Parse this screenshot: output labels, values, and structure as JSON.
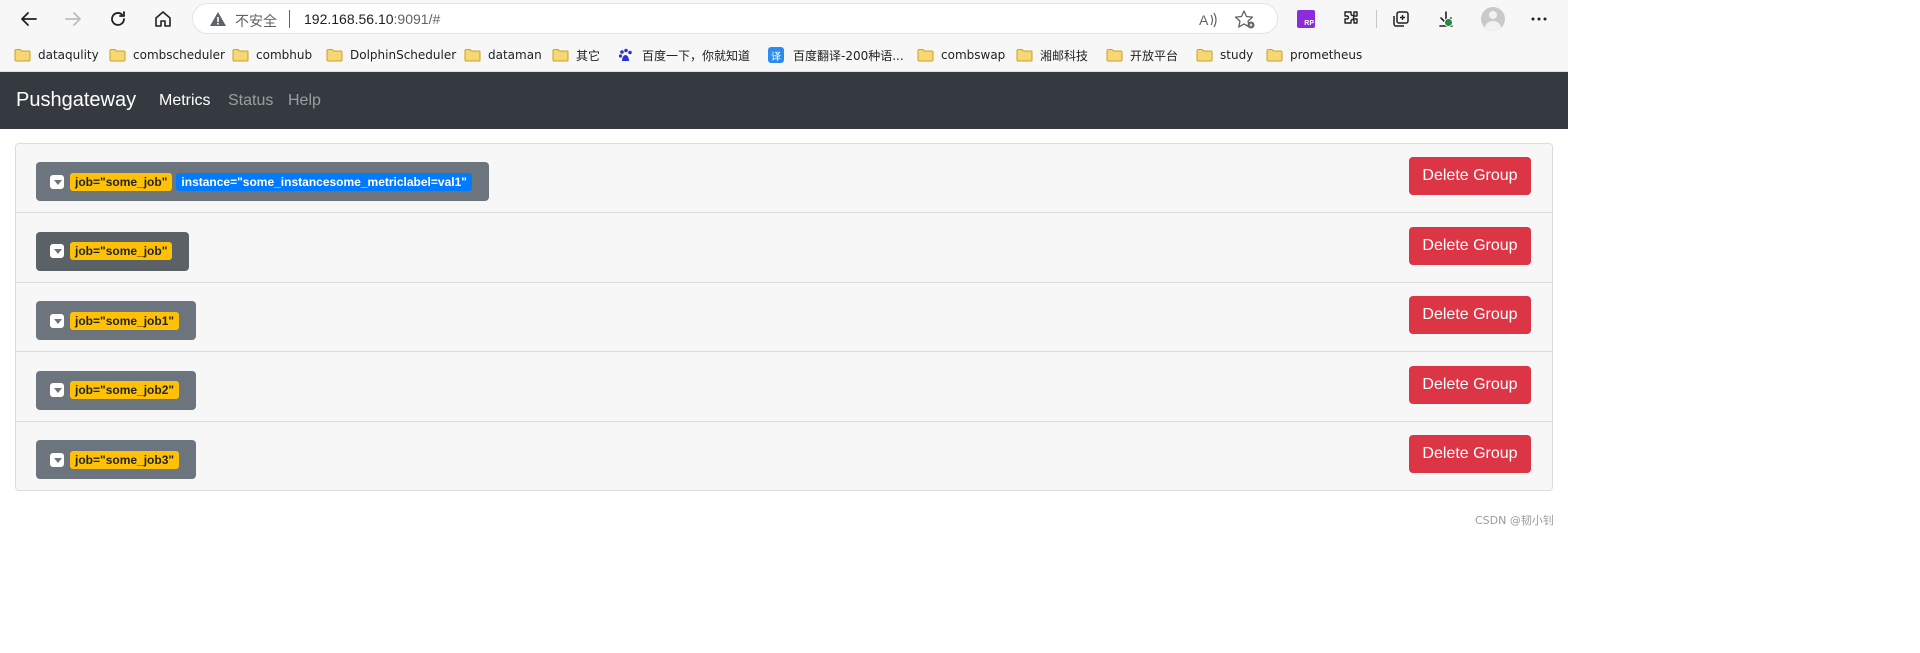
{
  "browser": {
    "security_label": "不安全",
    "url_host": "192.168.56.10",
    "url_rest": ":9091/#",
    "extension_rp_label": "RP"
  },
  "bookmarks": [
    {
      "label": "dataqulity",
      "icon": "folder-icon"
    },
    {
      "label": "combscheduler",
      "icon": "folder-icon"
    },
    {
      "label": "combhub",
      "icon": "folder-icon"
    },
    {
      "label": "DolphinScheduler",
      "icon": "folder-icon"
    },
    {
      "label": "dataman",
      "icon": "folder-icon"
    },
    {
      "label": "其它",
      "icon": "folder-icon"
    },
    {
      "label": "百度一下，你就知道",
      "icon": "baidu-icon"
    },
    {
      "label": "百度翻译-200种语...",
      "icon": "fanyi-icon",
      "icon_text": "译"
    },
    {
      "label": "combswap",
      "icon": "folder-icon"
    },
    {
      "label": "湘邮科技",
      "icon": "folder-icon"
    },
    {
      "label": "开放平台",
      "icon": "folder-icon"
    },
    {
      "label": "study",
      "icon": "folder-icon"
    },
    {
      "label": "prometheus",
      "icon": "folder-icon"
    }
  ],
  "navbar": {
    "brand": "Pushgateway",
    "links": [
      {
        "label": "Metrics",
        "active": true
      },
      {
        "label": "Status",
        "active": false
      },
      {
        "label": "Help",
        "active": false
      }
    ]
  },
  "groups": [
    {
      "labels": [
        "job=\"some_job\"",
        "instance=\"some_instancesome_metriclabel=val1\""
      ],
      "delete_label": "Delete Group"
    },
    {
      "labels": [
        "job=\"some_job\""
      ],
      "delete_label": "Delete Group"
    },
    {
      "labels": [
        "job=\"some_job1\""
      ],
      "delete_label": "Delete Group"
    },
    {
      "labels": [
        "job=\"some_job2\""
      ],
      "delete_label": "Delete Group"
    },
    {
      "labels": [
        "job=\"some_job3\""
      ],
      "delete_label": "Delete Group"
    }
  ],
  "watermark": "CSDN @韧小钊",
  "colors": {
    "navbar": "#343a40",
    "badge_job": "#ffc107",
    "badge_instance": "#007bff",
    "toggle_button": "#6c757d",
    "delete_button": "#dc3545"
  }
}
